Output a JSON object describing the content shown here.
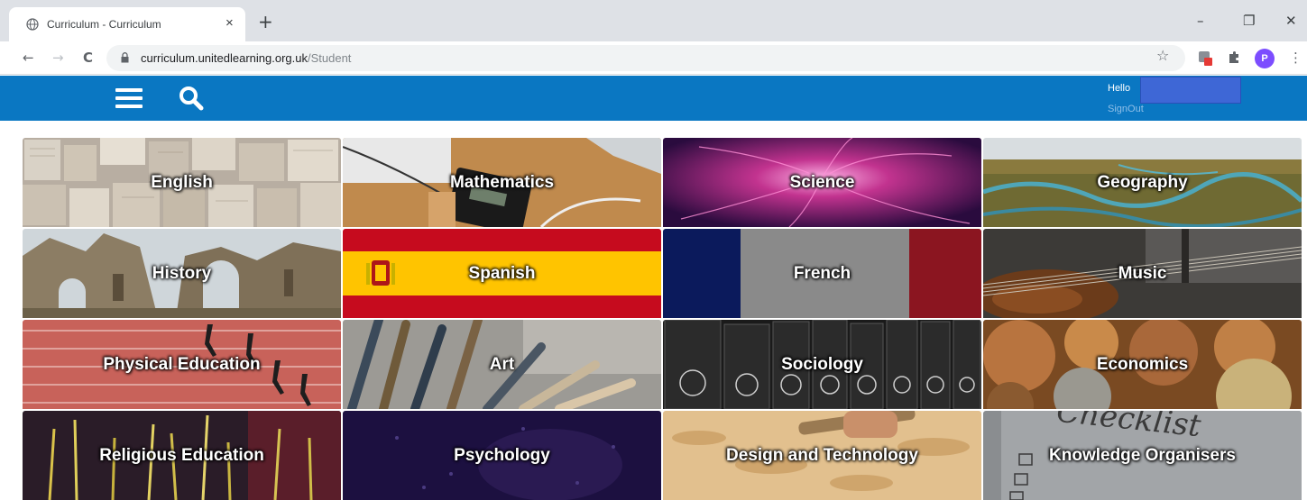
{
  "browser": {
    "tab_title": "Curriculum - Curriculum",
    "tab_close": "×",
    "new_tab": "+",
    "minimize": "–",
    "restore": "❐",
    "close": "✕",
    "back": "←",
    "forward": "→",
    "reload": "C",
    "url_host": "curriculum.unitedlearning.org.uk",
    "url_path": "/Student",
    "star": "☆",
    "profile_initial": "P",
    "menu": "⋮"
  },
  "header": {
    "hello": "Hello",
    "signout": "SignOut",
    "brand_color": "#0a77c2"
  },
  "subjects": [
    {
      "label": "English"
    },
    {
      "label": "Mathematics"
    },
    {
      "label": "Science"
    },
    {
      "label": "Geography"
    },
    {
      "label": "History"
    },
    {
      "label": "Spanish"
    },
    {
      "label": "French"
    },
    {
      "label": "Music"
    },
    {
      "label": "Physical Education"
    },
    {
      "label": "Art"
    },
    {
      "label": "Sociology"
    },
    {
      "label": "Economics"
    },
    {
      "label": "Religious Education"
    },
    {
      "label": "Psychology"
    },
    {
      "label": "Design and Technology"
    },
    {
      "label": "Knowledge Organisers"
    }
  ]
}
